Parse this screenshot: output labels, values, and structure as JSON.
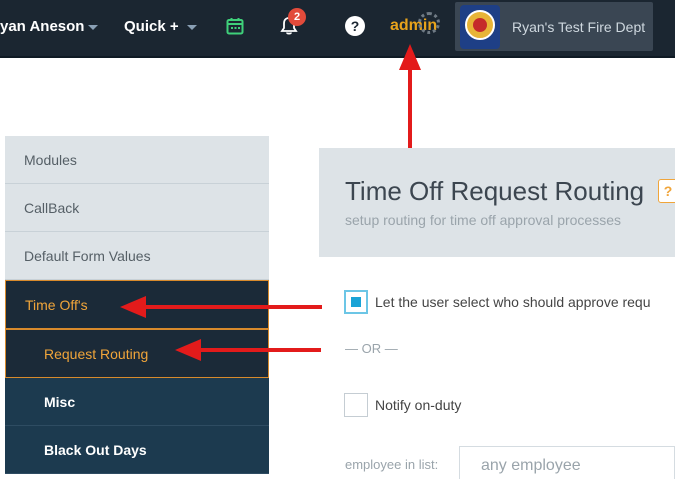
{
  "topbar": {
    "user_name": "yan Aneson",
    "quick_label": "Quick +",
    "notification_count": "2",
    "help_glyph": "?",
    "admin_label": "admin",
    "department_name": "Ryan's Test Fire Dept",
    "icons": [
      "calendar-icon",
      "bell-icon",
      "help-icon",
      "gear-icon",
      "fire-dept-logo"
    ]
  },
  "sidebar": {
    "items": [
      {
        "label": "Modules"
      },
      {
        "label": "CallBack"
      },
      {
        "label": "Default Form Values"
      },
      {
        "label": "Time Off's"
      },
      {
        "label": "Request Routing"
      },
      {
        "label": "Misc"
      },
      {
        "label": "Black Out Days"
      }
    ]
  },
  "main": {
    "title": "Time Off Request Routing",
    "subtitle": "setup routing for time off approval processes",
    "help_glyph": "?",
    "option_user_select": "Let the user select who should approve requ",
    "option_user_select_checked": true,
    "or_label": "— OR —",
    "option_notify_on_duty": "Notify on-duty",
    "option_notify_on_duty_checked": false,
    "employee_list_label": "employee in list:",
    "employee_list_value": "any employee"
  },
  "colors": {
    "topbar_bg": "#1b2631",
    "accent_orange": "#f0a53a",
    "sidebar_dark": "#1c3a4f",
    "annotation_red": "#e31b1b",
    "checkbox_blue": "#19a3d6"
  }
}
